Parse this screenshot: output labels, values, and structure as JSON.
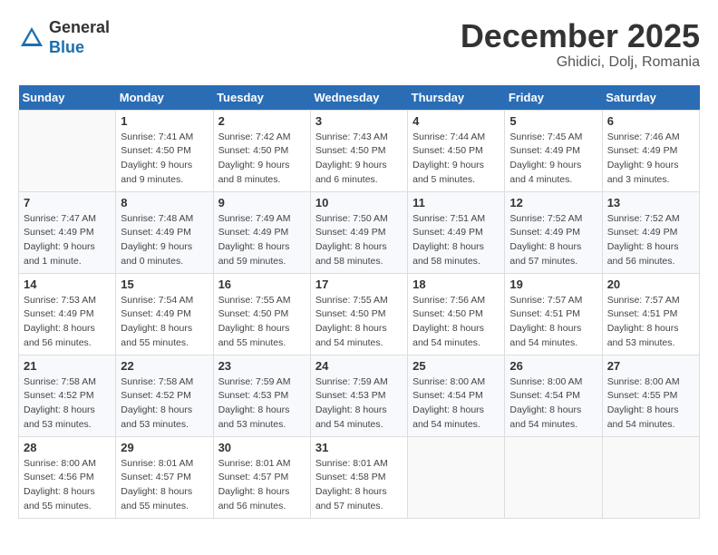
{
  "header": {
    "logo_line1": "General",
    "logo_line2": "Blue",
    "month": "December 2025",
    "location": "Ghidici, Dolj, Romania"
  },
  "weekdays": [
    "Sunday",
    "Monday",
    "Tuesday",
    "Wednesday",
    "Thursday",
    "Friday",
    "Saturday"
  ],
  "weeks": [
    [
      {
        "day": "",
        "info": ""
      },
      {
        "day": "1",
        "info": "Sunrise: 7:41 AM\nSunset: 4:50 PM\nDaylight: 9 hours\nand 9 minutes."
      },
      {
        "day": "2",
        "info": "Sunrise: 7:42 AM\nSunset: 4:50 PM\nDaylight: 9 hours\nand 8 minutes."
      },
      {
        "day": "3",
        "info": "Sunrise: 7:43 AM\nSunset: 4:50 PM\nDaylight: 9 hours\nand 6 minutes."
      },
      {
        "day": "4",
        "info": "Sunrise: 7:44 AM\nSunset: 4:50 PM\nDaylight: 9 hours\nand 5 minutes."
      },
      {
        "day": "5",
        "info": "Sunrise: 7:45 AM\nSunset: 4:49 PM\nDaylight: 9 hours\nand 4 minutes."
      },
      {
        "day": "6",
        "info": "Sunrise: 7:46 AM\nSunset: 4:49 PM\nDaylight: 9 hours\nand 3 minutes."
      }
    ],
    [
      {
        "day": "7",
        "info": "Sunrise: 7:47 AM\nSunset: 4:49 PM\nDaylight: 9 hours\nand 1 minute."
      },
      {
        "day": "8",
        "info": "Sunrise: 7:48 AM\nSunset: 4:49 PM\nDaylight: 9 hours\nand 0 minutes."
      },
      {
        "day": "9",
        "info": "Sunrise: 7:49 AM\nSunset: 4:49 PM\nDaylight: 8 hours\nand 59 minutes."
      },
      {
        "day": "10",
        "info": "Sunrise: 7:50 AM\nSunset: 4:49 PM\nDaylight: 8 hours\nand 58 minutes."
      },
      {
        "day": "11",
        "info": "Sunrise: 7:51 AM\nSunset: 4:49 PM\nDaylight: 8 hours\nand 58 minutes."
      },
      {
        "day": "12",
        "info": "Sunrise: 7:52 AM\nSunset: 4:49 PM\nDaylight: 8 hours\nand 57 minutes."
      },
      {
        "day": "13",
        "info": "Sunrise: 7:52 AM\nSunset: 4:49 PM\nDaylight: 8 hours\nand 56 minutes."
      }
    ],
    [
      {
        "day": "14",
        "info": "Sunrise: 7:53 AM\nSunset: 4:49 PM\nDaylight: 8 hours\nand 56 minutes."
      },
      {
        "day": "15",
        "info": "Sunrise: 7:54 AM\nSunset: 4:49 PM\nDaylight: 8 hours\nand 55 minutes."
      },
      {
        "day": "16",
        "info": "Sunrise: 7:55 AM\nSunset: 4:50 PM\nDaylight: 8 hours\nand 55 minutes."
      },
      {
        "day": "17",
        "info": "Sunrise: 7:55 AM\nSunset: 4:50 PM\nDaylight: 8 hours\nand 54 minutes."
      },
      {
        "day": "18",
        "info": "Sunrise: 7:56 AM\nSunset: 4:50 PM\nDaylight: 8 hours\nand 54 minutes."
      },
      {
        "day": "19",
        "info": "Sunrise: 7:57 AM\nSunset: 4:51 PM\nDaylight: 8 hours\nand 54 minutes."
      },
      {
        "day": "20",
        "info": "Sunrise: 7:57 AM\nSunset: 4:51 PM\nDaylight: 8 hours\nand 53 minutes."
      }
    ],
    [
      {
        "day": "21",
        "info": "Sunrise: 7:58 AM\nSunset: 4:52 PM\nDaylight: 8 hours\nand 53 minutes."
      },
      {
        "day": "22",
        "info": "Sunrise: 7:58 AM\nSunset: 4:52 PM\nDaylight: 8 hours\nand 53 minutes."
      },
      {
        "day": "23",
        "info": "Sunrise: 7:59 AM\nSunset: 4:53 PM\nDaylight: 8 hours\nand 53 minutes."
      },
      {
        "day": "24",
        "info": "Sunrise: 7:59 AM\nSunset: 4:53 PM\nDaylight: 8 hours\nand 54 minutes."
      },
      {
        "day": "25",
        "info": "Sunrise: 8:00 AM\nSunset: 4:54 PM\nDaylight: 8 hours\nand 54 minutes."
      },
      {
        "day": "26",
        "info": "Sunrise: 8:00 AM\nSunset: 4:54 PM\nDaylight: 8 hours\nand 54 minutes."
      },
      {
        "day": "27",
        "info": "Sunrise: 8:00 AM\nSunset: 4:55 PM\nDaylight: 8 hours\nand 54 minutes."
      }
    ],
    [
      {
        "day": "28",
        "info": "Sunrise: 8:00 AM\nSunset: 4:56 PM\nDaylight: 8 hours\nand 55 minutes."
      },
      {
        "day": "29",
        "info": "Sunrise: 8:01 AM\nSunset: 4:57 PM\nDaylight: 8 hours\nand 55 minutes."
      },
      {
        "day": "30",
        "info": "Sunrise: 8:01 AM\nSunset: 4:57 PM\nDaylight: 8 hours\nand 56 minutes."
      },
      {
        "day": "31",
        "info": "Sunrise: 8:01 AM\nSunset: 4:58 PM\nDaylight: 8 hours\nand 57 minutes."
      },
      {
        "day": "",
        "info": ""
      },
      {
        "day": "",
        "info": ""
      },
      {
        "day": "",
        "info": ""
      }
    ]
  ]
}
